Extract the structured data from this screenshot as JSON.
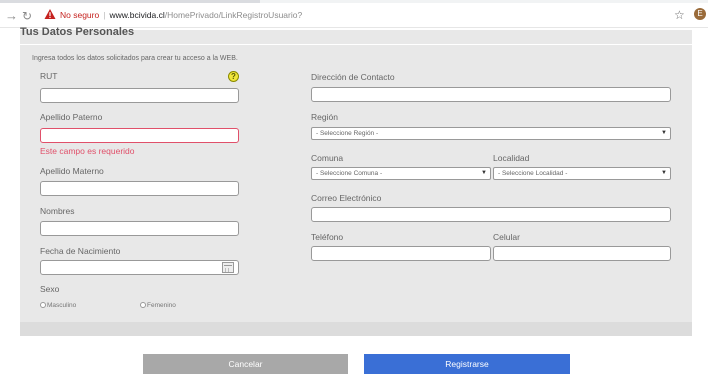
{
  "browser": {
    "insecure_label": "No seguro",
    "separator": "|",
    "url_domain": "www.bcivida.cl",
    "url_path": "/HomePrivado/LinkRegistroUsuario?",
    "avatar_letter": "E"
  },
  "form": {
    "title": "Tus Datos Personales",
    "intro": "Ingresa todos los datos solicitados para crear tu acceso a la WEB.",
    "help_icon": "?",
    "left": {
      "rut_label": "RUT",
      "apellido_paterno_label": "Apellido Paterno",
      "apellido_paterno_error": "Este campo es requerido",
      "apellido_materno_label": "Apellido Materno",
      "nombres_label": "Nombres",
      "fecha_label": "Fecha de Nacimiento",
      "sexo_label": "Sexo",
      "sexo_options": [
        "Masculino",
        "Femenino"
      ]
    },
    "right": {
      "direccion_label": "Dirección de Contacto",
      "region_label": "Región",
      "region_placeholder": "- Seleccione Región -",
      "comuna_label": "Comuna",
      "comuna_placeholder": "- Seleccione Comuna -",
      "localidad_label": "Localidad",
      "localidad_placeholder": "- Seleccione Localidad -",
      "correo_label": "Correo Electrónico",
      "telefono_label": "Teléfono",
      "celular_label": "Celular"
    },
    "buttons": {
      "cancel": "Cancelar",
      "submit": "Registrarse"
    }
  },
  "colors": {
    "panel": "#e8e8e8",
    "error": "#e0506a",
    "submit_button": "#3a6fd6",
    "cancel_button": "#a8a8a8"
  }
}
